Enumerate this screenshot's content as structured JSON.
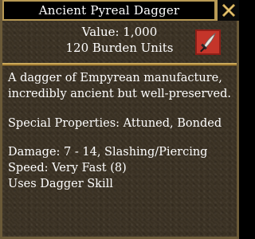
{
  "window": {
    "title": "Ancient Pyreal Dagger"
  },
  "icons": {
    "close": "close-x-icon",
    "item": "dagger-icon"
  },
  "colors": {
    "frame_gold": "#b89a55",
    "background": "#3b3224",
    "text": "#ffffff",
    "icon_bg": "#c4352a"
  },
  "header": {
    "value_line": "Value: 1,000",
    "burden_line": "120 Burden Units"
  },
  "description": {
    "line1": "A dagger of Empyrean manufacture,",
    "line2": "incredibly ancient but well-preserved."
  },
  "properties": {
    "special": "Special Properties: Attuned, Bonded",
    "damage": "Damage: 7 - 14, Slashing/Piercing",
    "speed": "Speed: Very Fast (8)",
    "skill": "Uses Dagger Skill"
  }
}
